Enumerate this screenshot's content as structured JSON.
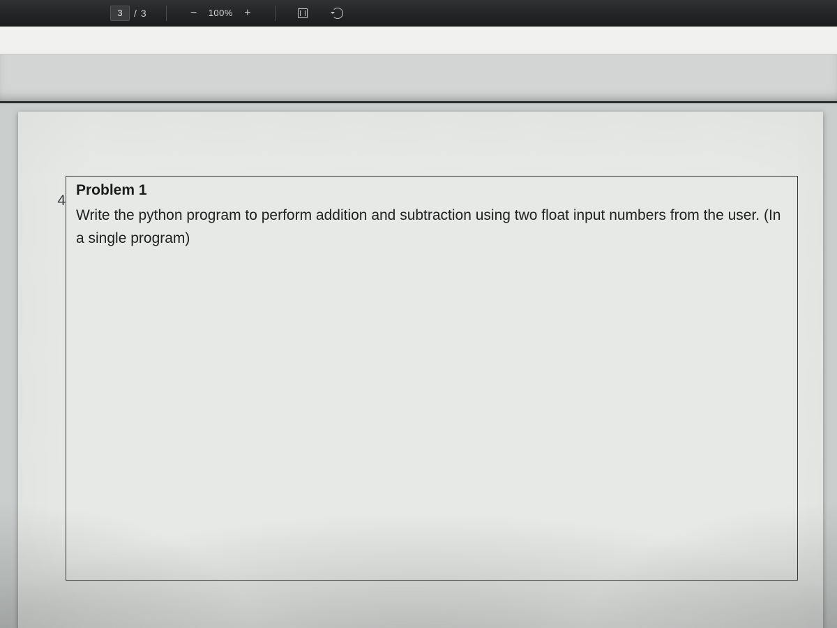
{
  "toolbar": {
    "page_current": "3",
    "page_sep": "/",
    "page_total": "3",
    "zoom_minus": "−",
    "zoom_text": "100%",
    "zoom_plus": "+"
  },
  "document": {
    "row_number": "4",
    "problem_title": "Problem 1",
    "problem_text": "Write the python program to perform addition and subtraction using two float input numbers from the user. (In a single program)"
  }
}
